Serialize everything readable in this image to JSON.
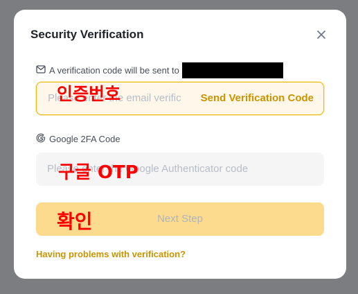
{
  "modal": {
    "title": "Security Verification",
    "close_icon": "close-icon"
  },
  "email": {
    "label": "A verification code will be sent to",
    "label_icon": "mail-icon",
    "placeholder": "Please enter the email verific",
    "send_code_label": "Send Verification Code"
  },
  "google2fa": {
    "label": "Google 2FA Code",
    "label_icon": "google-icon",
    "placeholder": "Please enter the Google Authenticator code"
  },
  "actions": {
    "next_label": "Next Step",
    "help_link": "Having problems with verification?"
  },
  "annotations": {
    "email_code": "인증번호",
    "otp": "구글 OTP",
    "confirm": "확인"
  },
  "colors": {
    "accent": "#c99400",
    "button_bg": "#fcdb8f",
    "annotation": "#ff0000"
  }
}
